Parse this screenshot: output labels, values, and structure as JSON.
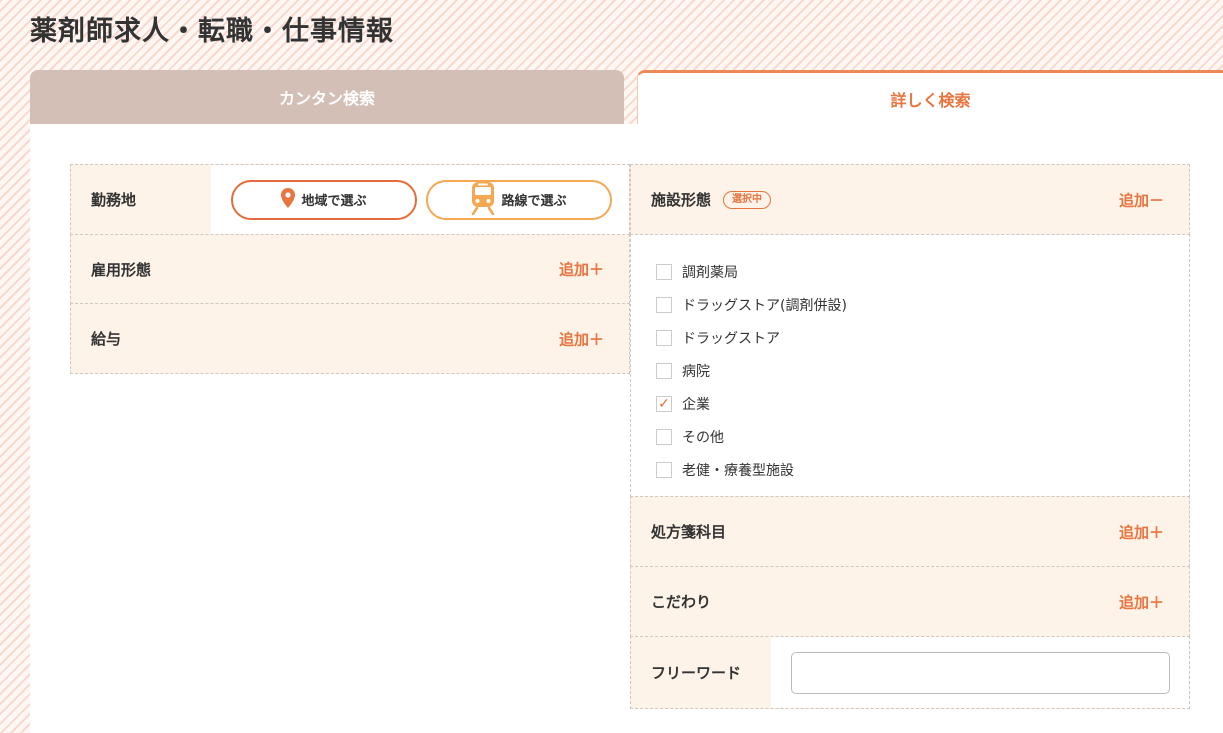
{
  "page": {
    "title": "薬剤師求人・転職・仕事情報"
  },
  "tabs": {
    "simple": "カンタン検索",
    "detail": "詳しく検索"
  },
  "location": {
    "label": "勤務地",
    "area_button": "地域で選ぶ",
    "line_button": "路線で選ぶ"
  },
  "employment": {
    "label": "雇用形態",
    "add": "追加＋"
  },
  "salary": {
    "label": "給与",
    "add": "追加＋"
  },
  "facility": {
    "label": "施設形態",
    "badge": "選択中",
    "toggle": "追加－",
    "options": [
      {
        "label": "調剤薬局",
        "checked": false
      },
      {
        "label": "ドラッグストア(調剤併設)",
        "checked": false
      },
      {
        "label": "ドラッグストア",
        "checked": false
      },
      {
        "label": "病院",
        "checked": false
      },
      {
        "label": "企業",
        "checked": true
      },
      {
        "label": "その他",
        "checked": false
      },
      {
        "label": "老健・療養型施設",
        "checked": false
      }
    ]
  },
  "prescription": {
    "label": "処方箋科目",
    "add": "追加＋"
  },
  "kodawari": {
    "label": "こだわり",
    "add": "追加＋"
  },
  "freeword": {
    "label": "フリーワード",
    "value": "",
    "placeholder": ""
  },
  "colors": {
    "accent": "#e8743f",
    "tab_inactive": "#d3bfb6",
    "row_bg": "#fdf3e8"
  }
}
